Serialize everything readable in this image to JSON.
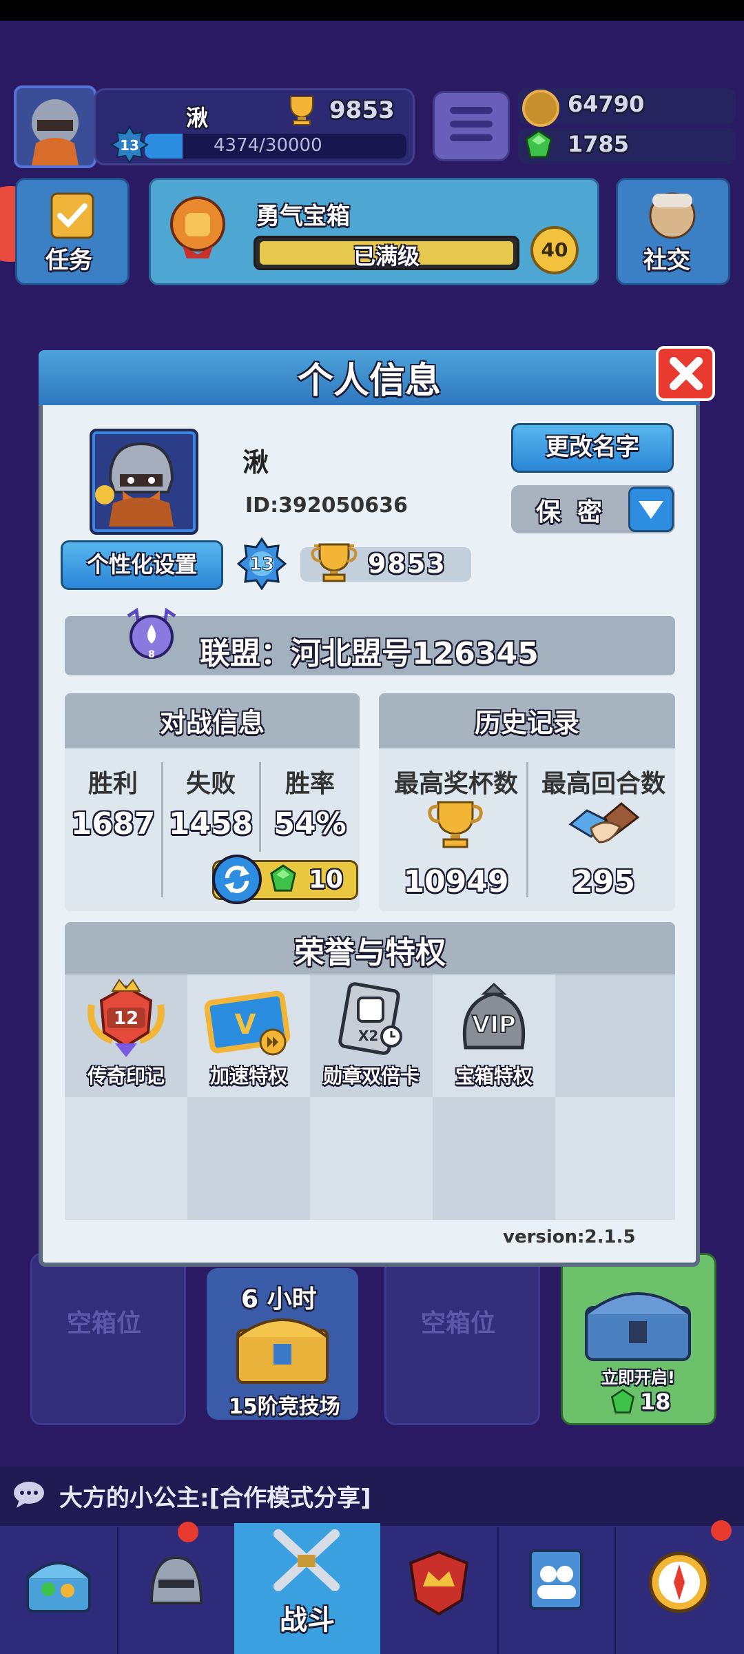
{
  "hud": {
    "player_name": "湫",
    "trophies": "9853",
    "xp": "4374/30000",
    "xp_fraction": 0.146,
    "level": "13",
    "coins": "64790",
    "gems": "1785"
  },
  "top_buttons": {
    "tasks": "任务",
    "chest_title": "勇气宝箱",
    "chest_status": "已满级",
    "chest_level": "40",
    "social": "社交"
  },
  "dialog": {
    "title": "个人信息",
    "player_name": "湫",
    "player_id": "ID:392050636",
    "rename_button": "更改名字",
    "privacy_value": "保密",
    "customize_button": "个性化设置",
    "level": "13",
    "trophies": "9853",
    "alliance": "联盟：河北盟号126345",
    "alliance_badge_level": "8",
    "battle": {
      "title": "对战信息",
      "labels": [
        "胜利",
        "失败",
        "胜率"
      ],
      "values": [
        "1687",
        "1458",
        "54%"
      ],
      "refresh_cost": "10"
    },
    "history": {
      "title": "历史记录",
      "labels": [
        "最高奖杯数",
        "最高回合数"
      ],
      "values": [
        "10949",
        "295"
      ]
    },
    "honors": {
      "title": "荣誉与特权",
      "items": [
        {
          "label": "传奇印记",
          "badge": "12",
          "icon": "legend-emblem-icon"
        },
        {
          "label": "加速特权",
          "icon": "speed-card-icon"
        },
        {
          "label": "勋章双倍卡",
          "badge": "X2",
          "icon": "medal-double-card-icon"
        },
        {
          "label": "宝箱特权",
          "badge": "VIP",
          "icon": "vip-chest-icon"
        }
      ]
    },
    "version": "version:2.1.5"
  },
  "background": {
    "empty_slot_1": "空箱位",
    "chest_timer": "6 小时",
    "chest_name": "15阶竞技场",
    "empty_slot_2": "空箱位",
    "open_now": "立即开启!",
    "open_cost": "18",
    "chat": "大方的小公主:[合作模式分享]",
    "nav_battle": "战斗"
  },
  "colors": {
    "accent_blue": "#2a87d6",
    "close_red": "#e83a2e",
    "gold": "#e9c73f",
    "panel_gray": "#a7b3bf"
  }
}
